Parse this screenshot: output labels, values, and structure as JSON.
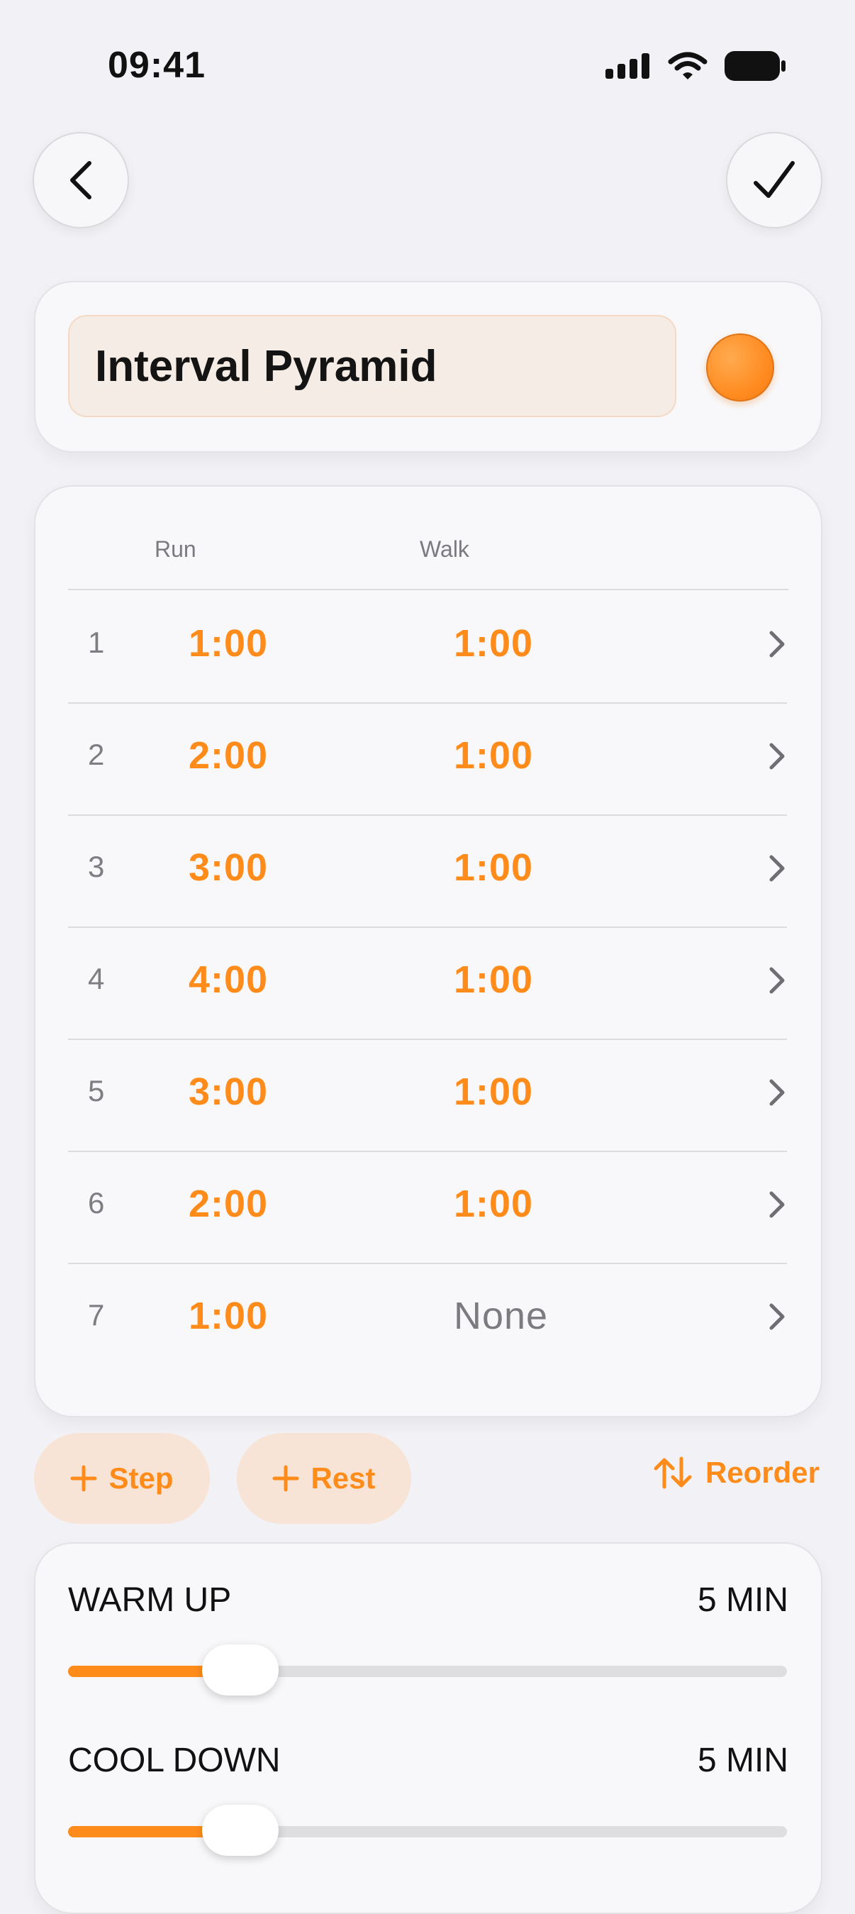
{
  "status_bar": {
    "time": "09:41"
  },
  "workout": {
    "name": "Interval Pyramid",
    "color": "#FF8C1A"
  },
  "table": {
    "headers": {
      "run": "Run",
      "walk": "Walk"
    },
    "rows": [
      {
        "index": "1",
        "run": "1:00",
        "walk": "1:00"
      },
      {
        "index": "2",
        "run": "2:00",
        "walk": "1:00"
      },
      {
        "index": "3",
        "run": "3:00",
        "walk": "1:00"
      },
      {
        "index": "4",
        "run": "4:00",
        "walk": "1:00"
      },
      {
        "index": "5",
        "run": "3:00",
        "walk": "1:00"
      },
      {
        "index": "6",
        "run": "2:00",
        "walk": "1:00"
      },
      {
        "index": "7",
        "run": "1:00",
        "walk": "None"
      }
    ]
  },
  "actions": {
    "step_label": "Step",
    "rest_label": "Rest",
    "reorder_label": "Reorder"
  },
  "settings": {
    "warm_up": {
      "label": "WARM UP",
      "value": "5 MIN",
      "fraction": 0.2
    },
    "cool_down": {
      "label": "COOL DOWN",
      "value": "5 MIN",
      "fraction": 0.2
    }
  },
  "icons": {
    "back": "chevron-left-icon",
    "done": "checkmark-icon",
    "row": "chevron-right-icon",
    "add": "plus-icon",
    "reorder": "swap-vertical-icon"
  }
}
